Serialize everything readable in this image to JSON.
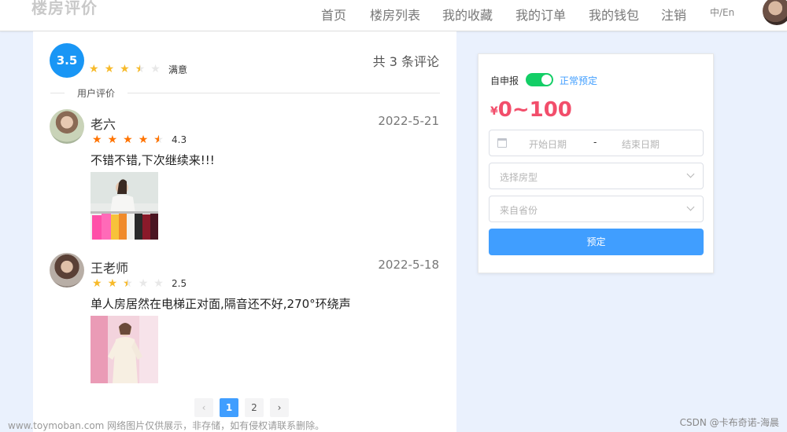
{
  "header": {
    "logo": "楼房评价",
    "nav": [
      "首页",
      "楼房列表",
      "我的收藏",
      "我的订单",
      "我的钱包",
      "注销"
    ],
    "lang": "中/En"
  },
  "summary": {
    "score": "3.5",
    "score_stars": 3.5,
    "score_label": "满意",
    "total": "共 3 条评论",
    "section_label": "用户评价"
  },
  "reviews": [
    {
      "name": "老六",
      "date": "2022-5-21",
      "rating": "4.3",
      "rating_value": 4.3,
      "text": "不错不错,下次继续来!!!"
    },
    {
      "name": "王老师",
      "date": "2022-5-18",
      "rating": "2.5",
      "rating_value": 2.5,
      "text": "单人房居然在电梯正对面,隔音还不好,270°环绕声"
    }
  ],
  "pagination": {
    "prev": "‹",
    "pages": [
      "1",
      "2"
    ],
    "current": "1",
    "next": "›"
  },
  "booking": {
    "switch_label": "自申报",
    "switch_on": true,
    "switch_status": "正常预定",
    "currency": "¥",
    "price_range": "0~100",
    "start_placeholder": "开始日期",
    "separator": "-",
    "end_placeholder": "结束日期",
    "room_type_placeholder": "选择房型",
    "province_placeholder": "来自省份",
    "book_label": "预定"
  },
  "footer": {
    "watermark": "www.toymoban.com 网络图片仅供展示，非存储，如有侵权请联系删除。",
    "credit": "CSDN @卡布奇诺-海晨"
  },
  "colors": {
    "accent": "#409eff",
    "score_badge": "#1996f5",
    "star_yellow": "#f7ba2a",
    "star_orange": "#ff7300",
    "price_red": "#f24e6b",
    "switch_green": "#13ce66",
    "page_bg": "#eaf1fd"
  }
}
